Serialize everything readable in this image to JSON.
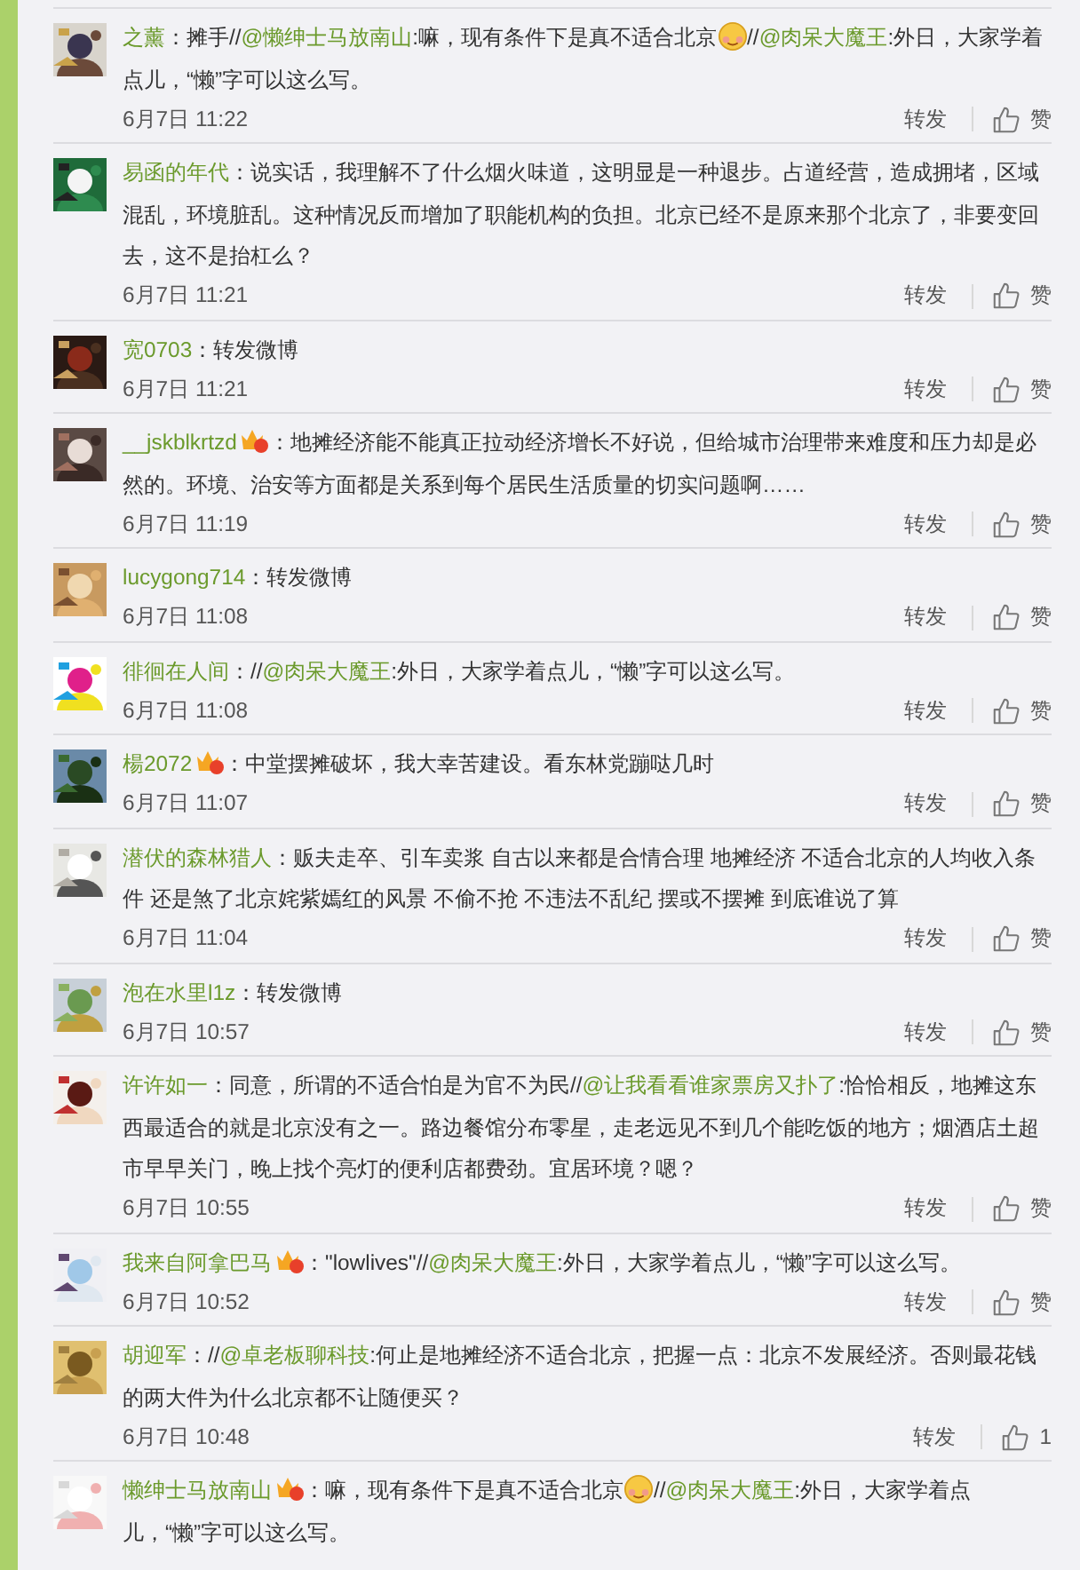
{
  "comments": [
    {
      "name": "之薰",
      "badge": false,
      "body": [
        {
          "kind": "text",
          "text": "：摊手//"
        },
        {
          "kind": "mention",
          "text": "@懒绅士马放南山"
        },
        {
          "kind": "text",
          "text": ":嘛，现有条件下是真不适合北京"
        },
        {
          "kind": "emoji"
        },
        {
          "kind": "text",
          "text": "//"
        },
        {
          "kind": "mention",
          "text": "@肉呆大魔王"
        },
        {
          "kind": "text",
          "text": ":外日，大家学着点儿，“懒”字可以这么写。"
        }
      ],
      "time": "6月7日 11:22",
      "repost": "转发",
      "like": "赞"
    },
    {
      "name": "易函的年代",
      "badge": false,
      "body": [
        {
          "kind": "text",
          "text": "：说实话，我理解不了什么烟火味道，这明显是一种退步。占道经营，造成拥堵，区域混乱，环境脏乱。这种情况反而增加了职能机构的负担。北京已经不是原来那个北京了，非要变回去，这不是抬杠么？"
        }
      ],
      "time": "6月7日 11:21",
      "repost": "转发",
      "like": "赞"
    },
    {
      "name": "宽0703",
      "badge": false,
      "body": [
        {
          "kind": "text",
          "text": "：转发微博"
        }
      ],
      "time": "6月7日 11:21",
      "repost": "转发",
      "like": "赞"
    },
    {
      "name": "__jskblkrtzd",
      "badge": true,
      "body": [
        {
          "kind": "text",
          "text": "：地摊经济能不能真正拉动经济增长不好说，但给城市治理带来难度和压力却是必然的。环境、治安等方面都是关系到每个居民生活质量的切实问题啊……"
        }
      ],
      "time": "6月7日 11:19",
      "repost": "转发",
      "like": "赞"
    },
    {
      "name": "lucygong714",
      "badge": false,
      "body": [
        {
          "kind": "text",
          "text": "：转发微博"
        }
      ],
      "time": "6月7日 11:08",
      "repost": "转发",
      "like": "赞"
    },
    {
      "name": "徘徊在人间",
      "badge": false,
      "body": [
        {
          "kind": "text",
          "text": "：//"
        },
        {
          "kind": "mention",
          "text": "@肉呆大魔王"
        },
        {
          "kind": "text",
          "text": ":外日，大家学着点儿，“懒”字可以这么写。"
        }
      ],
      "time": "6月7日 11:08",
      "repost": "转发",
      "like": "赞"
    },
    {
      "name": "楊2072",
      "badge": true,
      "body": [
        {
          "kind": "text",
          "text": "：中堂摆摊破坏，我大幸苦建设。看东林党蹦哒几时"
        }
      ],
      "time": "6月7日 11:07",
      "repost": "转发",
      "like": "赞"
    },
    {
      "name": "潜伏的森林猎人",
      "badge": false,
      "body": [
        {
          "kind": "text",
          "text": "：贩夫走卒、引车卖浆 自古以来都是合情合理 地摊经济 不适合北京的人均收入条件 还是煞了北京姹紫嫣红的风景 不偷不抢 不违法不乱纪 摆或不摆摊 到底谁说了算"
        }
      ],
      "time": "6月7日 11:04",
      "repost": "转发",
      "like": "赞"
    },
    {
      "name": "泡在水里l1z",
      "badge": false,
      "body": [
        {
          "kind": "text",
          "text": "：转发微博"
        }
      ],
      "time": "6月7日 10:57",
      "repost": "转发",
      "like": "赞"
    },
    {
      "name": "许许如一",
      "badge": false,
      "body": [
        {
          "kind": "text",
          "text": "：同意，所谓的不适合怕是为官不为民//"
        },
        {
          "kind": "mention",
          "text": "@让我看看谁家票房又扑了"
        },
        {
          "kind": "text",
          "text": ":恰恰相反，地摊这东西最适合的就是北京没有之一。路边餐馆分布零星，走老远见不到几个能吃饭的地方；烟酒店土超市早早关门，晚上找个亮灯的便利店都费劲。宜居环境？嗯？"
        }
      ],
      "time": "6月7日 10:55",
      "repost": "转发",
      "like": "赞"
    },
    {
      "name": "我来自阿拿巴马",
      "badge": true,
      "body": [
        {
          "kind": "text",
          "text": "：\"lowlives\"//"
        },
        {
          "kind": "mention",
          "text": "@肉呆大魔王"
        },
        {
          "kind": "text",
          "text": ":外日，大家学着点儿，“懒”字可以这么写。"
        }
      ],
      "time": "6月7日 10:52",
      "repost": "转发",
      "like": "赞"
    },
    {
      "name": "胡迎军",
      "badge": false,
      "body": [
        {
          "kind": "text",
          "text": "：//"
        },
        {
          "kind": "mention",
          "text": "@卓老板聊科技"
        },
        {
          "kind": "text",
          "text": ":何止是地摊经济不适合北京，把握一点：北京不发展经济。否则最花钱的两大件为什么北京都不让随便买？"
        }
      ],
      "time": "6月7日 10:48",
      "repost": "转发",
      "like": "1"
    },
    {
      "name": "懒绅士马放南山",
      "badge": true,
      "body": [
        {
          "kind": "text",
          "text": "：嘛，现有条件下是真不适合北京"
        },
        {
          "kind": "emoji"
        },
        {
          "kind": "text",
          "text": "//"
        },
        {
          "kind": "mention",
          "text": "@肉呆大魔王"
        },
        {
          "kind": "text",
          "text": ":外日，大家学着点儿，“懒”字可以这么写。"
        }
      ]
    }
  ]
}
